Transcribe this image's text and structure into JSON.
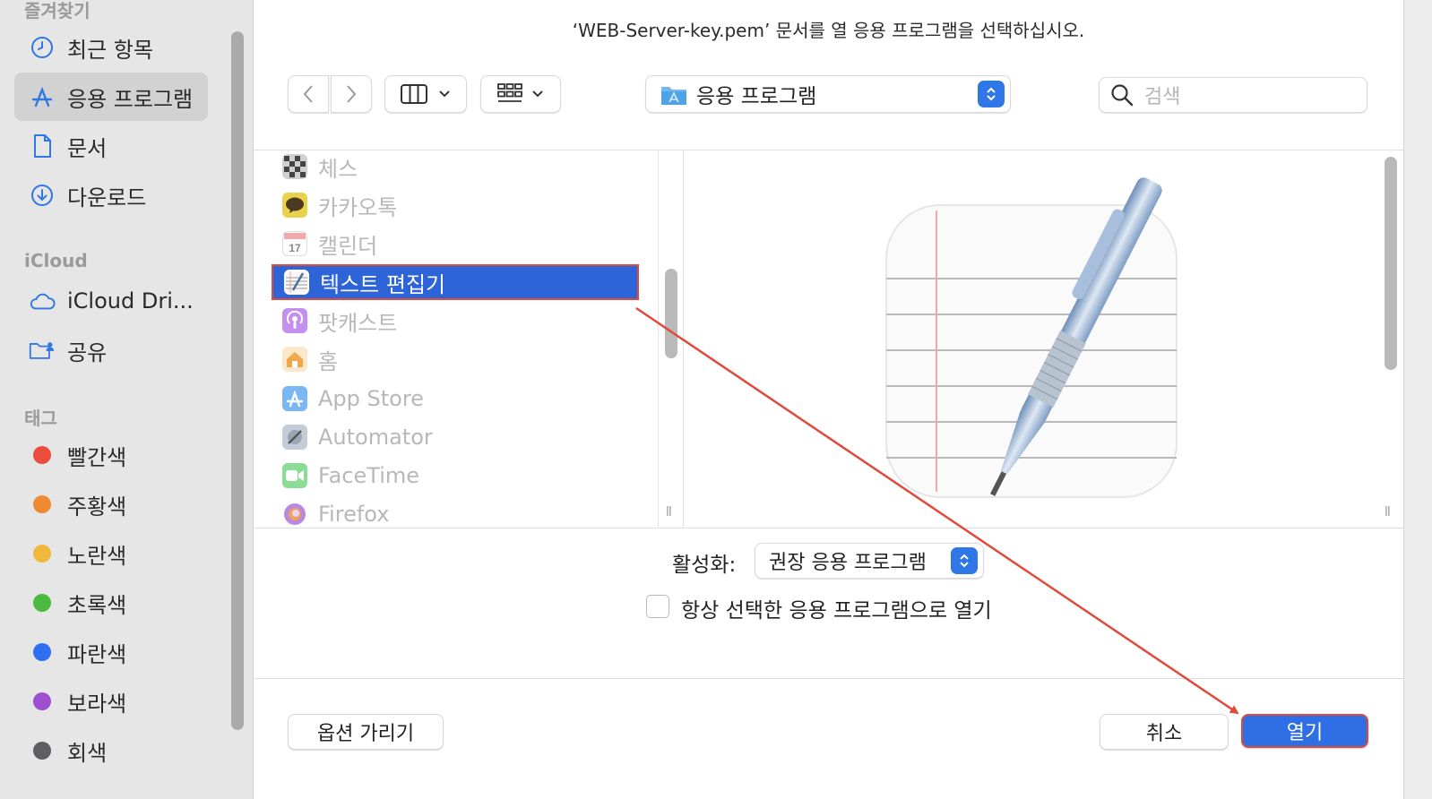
{
  "sidebar": {
    "favorites_header": "즐겨찾기",
    "favorites": [
      {
        "label": "최근 항목",
        "icon": "clock-icon"
      },
      {
        "label": "응용 프로그램",
        "icon": "applications-icon",
        "selected": true
      },
      {
        "label": "문서",
        "icon": "document-icon"
      },
      {
        "label": "다운로드",
        "icon": "download-icon"
      }
    ],
    "icloud_header": "iCloud",
    "icloud": [
      {
        "label": "iCloud Dri...",
        "icon": "cloud-icon"
      },
      {
        "label": "공유",
        "icon": "shared-folder-icon"
      }
    ],
    "tags_header": "태그",
    "tags": [
      {
        "label": "빨간색",
        "color": "#eb4d3d"
      },
      {
        "label": "주황색",
        "color": "#ef8a33"
      },
      {
        "label": "노란색",
        "color": "#f1b93b"
      },
      {
        "label": "초록색",
        "color": "#4cba3f"
      },
      {
        "label": "파란색",
        "color": "#2f6ff0"
      },
      {
        "label": "보라색",
        "color": "#9e4fd0"
      },
      {
        "label": "회색",
        "color": "#5e5e62"
      }
    ]
  },
  "dialog": {
    "title": "‘WEB-Server-key.pem’ 문서를 열 응용 프로그램을 선택하십시오.",
    "location": "응용 프로그램",
    "search_placeholder": "검색"
  },
  "apps": [
    {
      "label": "체스",
      "icon": "chess-icon",
      "color": "#6e6e6e"
    },
    {
      "label": "카카오톡",
      "icon": "kakaotalk-icon",
      "color": "#e8d24a"
    },
    {
      "label": "캘린더",
      "icon": "calendar-icon",
      "color": "#ffffff"
    },
    {
      "label": "텍스트 편집기",
      "icon": "textedit-icon",
      "color": "#ffffff",
      "selected": true
    },
    {
      "label": "팟캐스트",
      "icon": "podcasts-icon",
      "color": "#b06ee0"
    },
    {
      "label": "홈",
      "icon": "home-icon",
      "color": "#f2c27a"
    },
    {
      "label": "App Store",
      "icon": "appstore-icon",
      "color": "#4ea3f5"
    },
    {
      "label": "Automator",
      "icon": "automator-icon",
      "color": "#9aa6b5"
    },
    {
      "label": "FaceTime",
      "icon": "facetime-icon",
      "color": "#5ccb6a"
    },
    {
      "label": "Firefox",
      "icon": "firefox-icon",
      "color": "#8a4bd6"
    }
  ],
  "options": {
    "enable_label": "활성화:",
    "enable_value": "권장 응용 프로그램",
    "always_open_label": "항상 선택한 응용 프로그램으로 열기",
    "always_open_checked": false
  },
  "buttons": {
    "hide_options": "옵션 가리기",
    "cancel": "취소",
    "open": "열기"
  },
  "colors": {
    "accent": "#2f6fe5",
    "selection": "#2d64d8",
    "annotation": "#e04a3a"
  }
}
